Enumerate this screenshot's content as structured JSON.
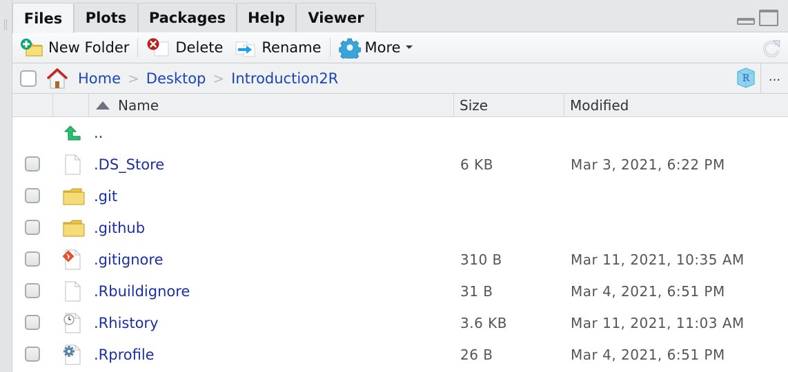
{
  "tabs": [
    {
      "label": "Files",
      "active": true
    },
    {
      "label": "Plots",
      "active": false
    },
    {
      "label": "Packages",
      "active": false
    },
    {
      "label": "Help",
      "active": false
    },
    {
      "label": "Viewer",
      "active": false
    }
  ],
  "toolbar": {
    "new_folder": "New Folder",
    "delete": "Delete",
    "rename": "Rename",
    "more": "More"
  },
  "breadcrumb": [
    {
      "label": "Home"
    },
    {
      "label": "Desktop"
    },
    {
      "label": "Introduction2R"
    }
  ],
  "pathbar": {
    "more_label": "..."
  },
  "columns": {
    "name": "Name",
    "size": "Size",
    "modified": "Modified"
  },
  "parent_dir": "..",
  "files": [
    {
      "name": ".DS_Store",
      "icon": "blank-file-icon",
      "size": "6 KB",
      "modified": "Mar 3, 2021, 6:22 PM"
    },
    {
      "name": ".git",
      "icon": "folder-icon",
      "size": "",
      "modified": ""
    },
    {
      "name": ".github",
      "icon": "folder-icon",
      "size": "",
      "modified": ""
    },
    {
      "name": ".gitignore",
      "icon": "git-file-icon",
      "size": "310 B",
      "modified": "Mar 11, 2021, 10:35 AM"
    },
    {
      "name": ".Rbuildignore",
      "icon": "blank-file-icon",
      "size": "31 B",
      "modified": "Mar 4, 2021, 6:51 PM"
    },
    {
      "name": ".Rhistory",
      "icon": "history-file-icon",
      "size": "3.6 KB",
      "modified": "Mar 11, 2021, 11:03 AM"
    },
    {
      "name": ".Rprofile",
      "icon": "settings-file-icon",
      "size": "26 B",
      "modified": "Mar 4, 2021, 6:51 PM"
    }
  ],
  "colors": {
    "link": "#1b2fa6",
    "breadcrumb": "#1a44b8",
    "muted_text": "#555555"
  }
}
